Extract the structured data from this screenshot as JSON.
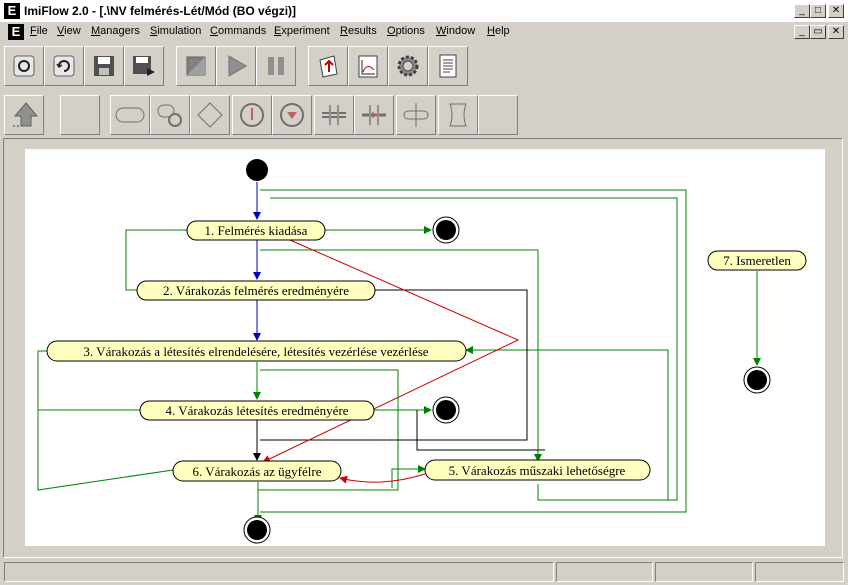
{
  "window": {
    "title": "ImiFlow 2.0 - [.\\NV felmérés-Lét/Mód (BO végzi)]",
    "app_icon": "E",
    "buttons": [
      "_",
      "□",
      "✕"
    ],
    "mdi_buttons": [
      "_",
      "▭",
      "✕"
    ]
  },
  "menu": {
    "items": [
      {
        "pre": "",
        "u": "F",
        "post": "ile"
      },
      {
        "pre": "",
        "u": "V",
        "post": "iew"
      },
      {
        "pre": "",
        "u": "M",
        "post": "anagers"
      },
      {
        "pre": "",
        "u": "S",
        "post": "imulation"
      },
      {
        "pre": "",
        "u": "C",
        "post": "ommands"
      },
      {
        "pre": "",
        "u": "E",
        "post": "xperiment"
      },
      {
        "pre": "",
        "u": "R",
        "post": "esults"
      },
      {
        "pre": "",
        "u": "O",
        "post": "ptions"
      },
      {
        "pre": "",
        "u": "W",
        "post": "indow"
      },
      {
        "pre": "",
        "u": "H",
        "post": "elp"
      }
    ]
  },
  "toolbar1": {
    "icons": [
      "new-icon",
      "open-icon",
      "save-icon",
      "save-as-icon",
      "stop-icon",
      "play-icon",
      "pause-icon",
      "export-icon",
      "chart-icon",
      "settings-gear-icon",
      "document-icon"
    ]
  },
  "toolbar2": {
    "icons": [
      "pointer-arrow-icon",
      "blank-tool",
      "state-shape-icon",
      "subprocess-shape-icon",
      "decision-diamond-icon",
      "start-node-icon",
      "end-node-icon",
      "fork-icon",
      "join-icon",
      "connector-icon",
      "document-shape-icon",
      "blank-tool-2"
    ]
  },
  "diagram": {
    "nodes": [
      "1. Felmérés kiadása",
      "2. Várakozás felmérés eredményére",
      "3. Várakozás a létesítés elrendelésére, létesítés vezérlése vezérlése",
      "4. Várakozás létesítés eredményére",
      "5. Várakozás műszaki lehetőségre",
      "6. Várakozás az ügyfélre",
      "7. Ismeretlen"
    ],
    "colors": {
      "node_fill": "#ffffc0",
      "green": "#008000",
      "blue": "#0000c0",
      "red": "#d00000",
      "black": "#000000"
    }
  },
  "status": {
    "panels": [
      "",
      "",
      "",
      ""
    ]
  }
}
